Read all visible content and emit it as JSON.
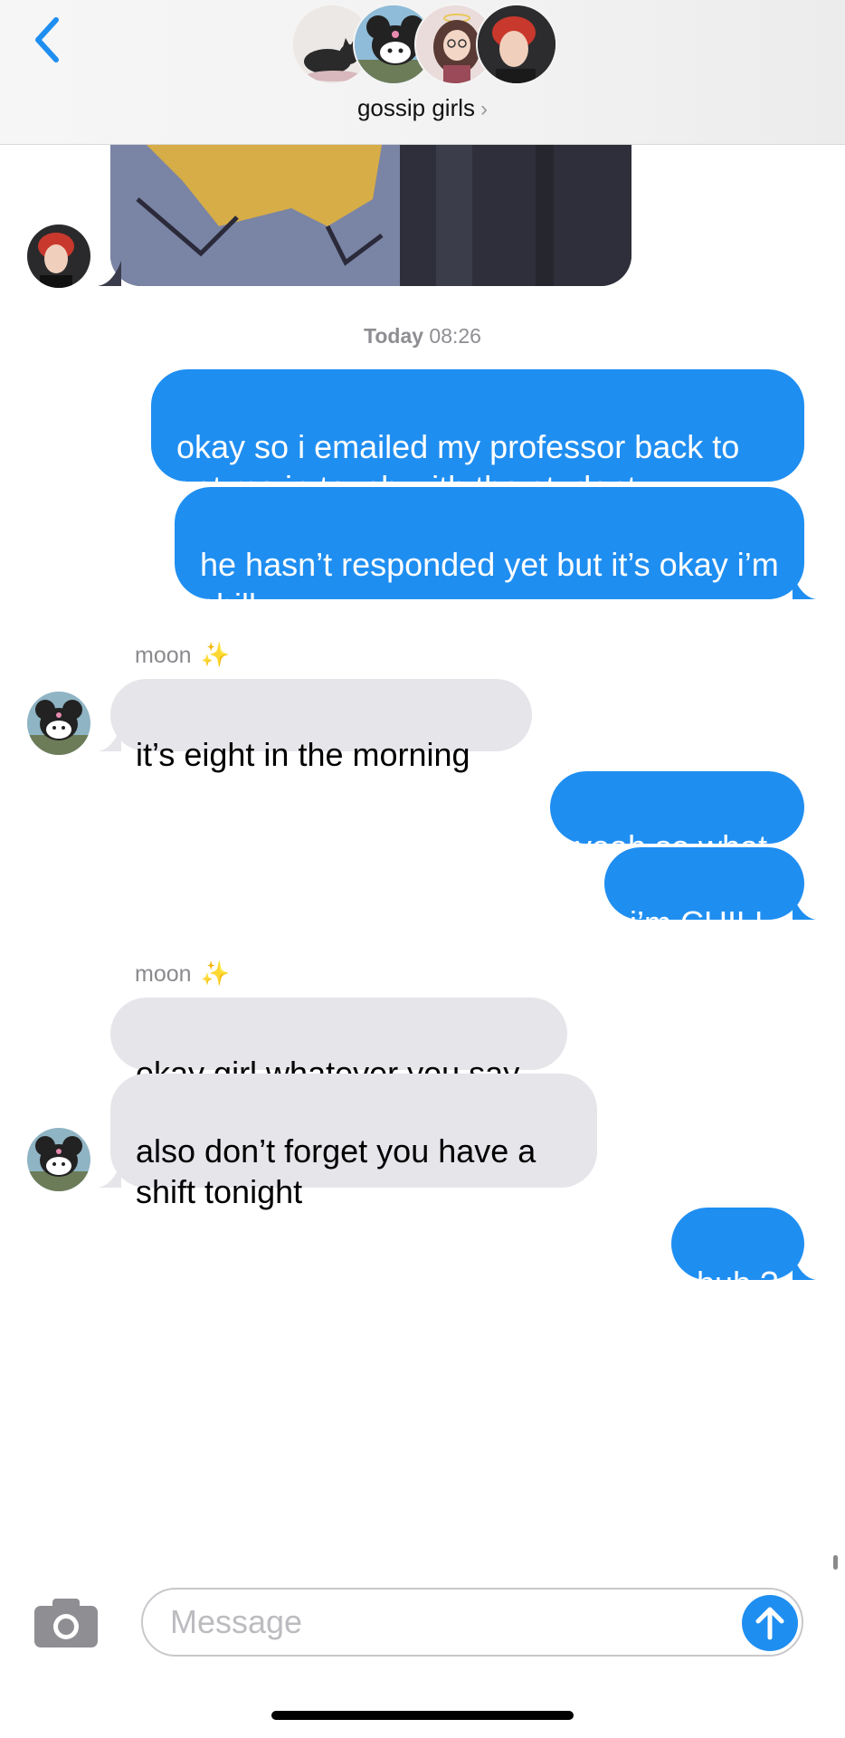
{
  "header": {
    "group_name": "gossip girls",
    "chevron": "›",
    "back_icon": "chevron-left-icon",
    "avatars": [
      "cat-avatar",
      "kuromi-avatar",
      "anime-girl-avatar",
      "red-hair-avatar"
    ]
  },
  "timestamp": {
    "day": "Today",
    "time": "08:26"
  },
  "messages": [
    {
      "from": "me",
      "text": "okay so i emailed my professor back to get me in touch with the student"
    },
    {
      "from": "me",
      "text": "he hasn’t responded yet but it’s okay i’m chill"
    },
    {
      "from": "moon",
      "sender": "moon",
      "sender_emoji": "✨",
      "text": "it’s eight in the morning"
    },
    {
      "from": "me",
      "text": "yeah so what"
    },
    {
      "from": "me",
      "text": "i’m CHILL"
    },
    {
      "from": "moon",
      "sender": "moon",
      "sender_emoji": "✨",
      "text": "okay girl whatever you say"
    },
    {
      "from": "moon",
      "text": "also don’t forget you have a shift tonight"
    },
    {
      "from": "me",
      "text": "huh ?"
    }
  ],
  "input": {
    "placeholder": "Message"
  },
  "colors": {
    "outgoing": "#1f8ef1",
    "incoming": "#e5e5ea",
    "accent": "#1f8ef1"
  }
}
